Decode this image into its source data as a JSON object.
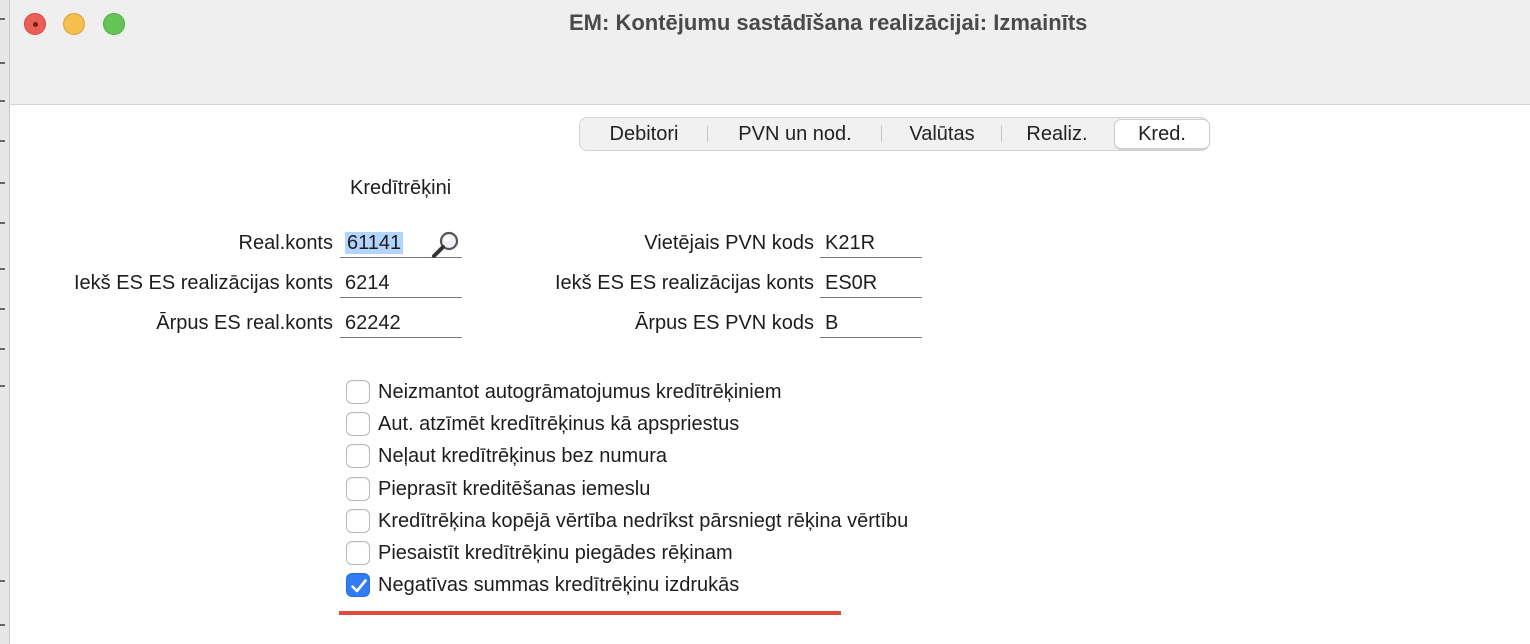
{
  "window": {
    "title": "EM: Kontējumu sastādīšana realizācijai: Izmainīts"
  },
  "tabs": [
    {
      "label": "Debitori",
      "active": false
    },
    {
      "label": "PVN un nod.",
      "active": false
    },
    {
      "label": "Valūtas",
      "active": false
    },
    {
      "label": "Realiz.",
      "active": false
    },
    {
      "label": "Kred.",
      "active": true
    }
  ],
  "section": {
    "label": "Kredītrēķini"
  },
  "fields_left": [
    {
      "label": "Real.konts",
      "value": "61141",
      "selected": true
    },
    {
      "label": "Iekš ES ES realizācijas konts",
      "value": "6214"
    },
    {
      "label": "Ārpus ES real.konts",
      "value": "62242"
    }
  ],
  "fields_right": [
    {
      "label": "Vietējais PVN kods",
      "value": "K21R"
    },
    {
      "label": "Iekš ES ES realizācijas konts",
      "value": "ES0R"
    },
    {
      "label": "Ārpus ES PVN kods",
      "value": "B"
    }
  ],
  "checkboxes": [
    {
      "label": "Neizmantot autogrāmatojumus kredītrēķiniem",
      "checked": false
    },
    {
      "label": "Aut. atzīmēt kredītrēķinus kā apspriestus",
      "checked": false
    },
    {
      "label": "Neļaut kredītrēķinus bez numura",
      "checked": false
    },
    {
      "label": "Pieprasīt kreditēšanas iemeslu",
      "checked": false
    },
    {
      "label": "Kredītrēķina kopējā vērtība nedrīkst pārsniegt rēķina vērtību",
      "checked": false
    },
    {
      "label": "Piesaistīt kredītrēķinu piegādes rēķinam",
      "checked": false
    },
    {
      "label": "Negatīvas summas kredītrēķinu izdrukās",
      "checked": true
    }
  ],
  "colors": {
    "accent": "#2f7cf6",
    "selection": "#b3d4fd",
    "annotation": "#e24a3b"
  },
  "icons": {
    "lookup": "magnifier-icon",
    "check": "checkmark-icon"
  }
}
